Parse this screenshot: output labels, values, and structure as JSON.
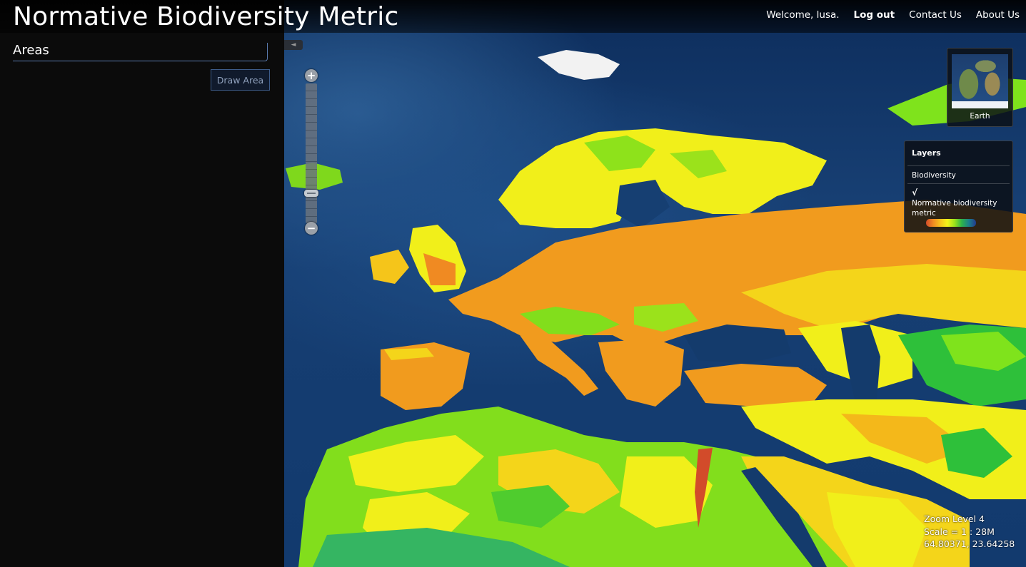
{
  "header": {
    "title": "Normative Biodiversity Metric",
    "welcome": "Welcome, lusa.",
    "logout": "Log out",
    "contact": "Contact Us",
    "about": "About Us"
  },
  "left_panel": {
    "heading": "Areas",
    "draw_button": "Draw Area",
    "collapse_glyph": "◄"
  },
  "zoom": {
    "in_glyph": "+",
    "out_glyph": "−",
    "level_fraction": 0.8
  },
  "overview": {
    "label": "Earth"
  },
  "layers": {
    "title": "Layers",
    "items": [
      {
        "label": "Biodiversity",
        "checked": false
      },
      {
        "label": "Normative biodiversity metric",
        "checked": true
      }
    ],
    "check_glyph": "√",
    "legend_colors": [
      "#d24b2a",
      "#f08a22",
      "#f6c21c",
      "#f3f31a",
      "#9be21b",
      "#2db34a",
      "#1b7f8a",
      "#223a8f"
    ]
  },
  "map_info": {
    "zoom_level": "Zoom Level 4",
    "scale": "Scale = 1 : 28M",
    "coords": "64.80371, 23.64258"
  },
  "icons": [
    "collapse-arrow-icon",
    "zoom-in-icon",
    "zoom-out-icon",
    "check-icon",
    "globe-icon"
  ]
}
